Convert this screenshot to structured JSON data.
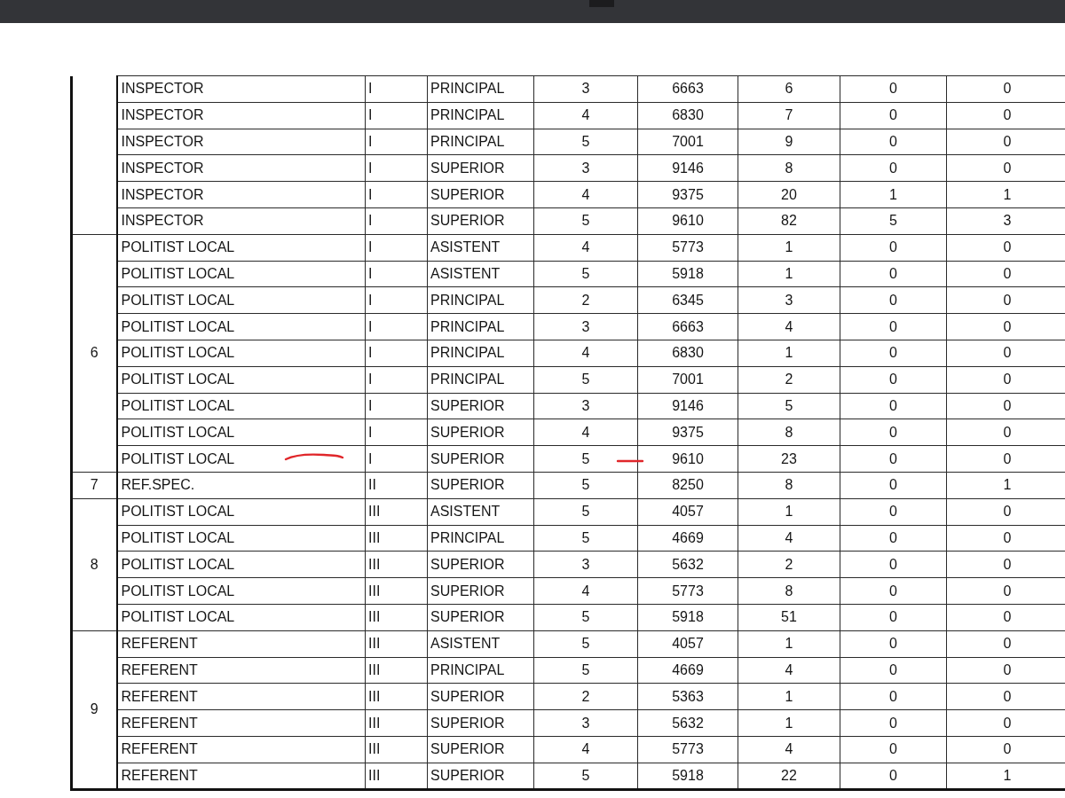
{
  "groups": [
    {
      "rows": [
        [
          "INSPECTOR",
          "I",
          "PRINCIPAL",
          "3",
          "6663",
          "6",
          "0",
          "0"
        ],
        [
          "INSPECTOR",
          "I",
          "PRINCIPAL",
          "4",
          "6830",
          "7",
          "0",
          "0"
        ],
        [
          "INSPECTOR",
          "I",
          "PRINCIPAL",
          "5",
          "7001",
          "9",
          "0",
          "0"
        ],
        [
          "INSPECTOR",
          "I",
          "SUPERIOR",
          "3",
          "9146",
          "8",
          "0",
          "0"
        ],
        [
          "INSPECTOR",
          "I",
          "SUPERIOR",
          "4",
          "9375",
          "20",
          "1",
          "1"
        ],
        [
          "INSPECTOR",
          "I",
          "SUPERIOR",
          "5",
          "9610",
          "82",
          "5",
          "3"
        ]
      ]
    },
    {
      "number": "6",
      "rows": [
        [
          "POLITIST LOCAL",
          "I",
          "ASISTENT",
          "4",
          "5773",
          "1",
          "0",
          "0"
        ],
        [
          "POLITIST LOCAL",
          "I",
          "ASISTENT",
          "5",
          "5918",
          "1",
          "0",
          "0"
        ],
        [
          "POLITIST LOCAL",
          "I",
          "PRINCIPAL",
          "2",
          "6345",
          "3",
          "0",
          "0"
        ],
        [
          "POLITIST LOCAL",
          "I",
          "PRINCIPAL",
          "3",
          "6663",
          "4",
          "0",
          "0"
        ],
        [
          "POLITIST LOCAL",
          "I",
          "PRINCIPAL",
          "4",
          "6830",
          "1",
          "0",
          "0"
        ],
        [
          "POLITIST LOCAL",
          "I",
          "PRINCIPAL",
          "5",
          "7001",
          "2",
          "0",
          "0"
        ],
        [
          "POLITIST LOCAL",
          "I",
          "SUPERIOR",
          "3",
          "9146",
          "5",
          "0",
          "0"
        ],
        [
          "POLITIST LOCAL",
          "I",
          "SUPERIOR",
          "4",
          "9375",
          "8",
          "0",
          "0"
        ],
        [
          "POLITIST LOCAL",
          "I",
          "SUPERIOR",
          "5",
          "9610",
          "23",
          "0",
          "0"
        ]
      ]
    },
    {
      "number": "7",
      "rows": [
        [
          "REF.SPEC.",
          "II",
          "SUPERIOR",
          "5",
          "8250",
          "8",
          "0",
          "1"
        ]
      ]
    },
    {
      "number": "8",
      "rows": [
        [
          "POLITIST LOCAL",
          "III",
          "ASISTENT",
          "5",
          "4057",
          "1",
          "0",
          "0"
        ],
        [
          "POLITIST LOCAL",
          "III",
          "PRINCIPAL",
          "5",
          "4669",
          "4",
          "0",
          "0"
        ],
        [
          "POLITIST LOCAL",
          "III",
          "SUPERIOR",
          "3",
          "5632",
          "2",
          "0",
          "0"
        ],
        [
          "POLITIST LOCAL",
          "III",
          "SUPERIOR",
          "4",
          "5773",
          "8",
          "0",
          "0"
        ],
        [
          "POLITIST LOCAL",
          "III",
          "SUPERIOR",
          "5",
          "5918",
          "51",
          "0",
          "0"
        ]
      ]
    },
    {
      "number": "9",
      "rows": [
        [
          "REFERENT",
          "III",
          "ASISTENT",
          "5",
          "4057",
          "1",
          "0",
          "0"
        ],
        [
          "REFERENT",
          "III",
          "PRINCIPAL",
          "5",
          "4669",
          "4",
          "0",
          "0"
        ],
        [
          "REFERENT",
          "III",
          "SUPERIOR",
          "2",
          "5363",
          "1",
          "0",
          "0"
        ],
        [
          "REFERENT",
          "III",
          "SUPERIOR",
          "3",
          "5632",
          "1",
          "0",
          "0"
        ],
        [
          "REFERENT",
          "III",
          "SUPERIOR",
          "4",
          "5773",
          "4",
          "0",
          "0"
        ],
        [
          "REFERENT",
          "III",
          "SUPERIOR",
          "5",
          "5918",
          "22",
          "0",
          "1"
        ]
      ]
    }
  ]
}
